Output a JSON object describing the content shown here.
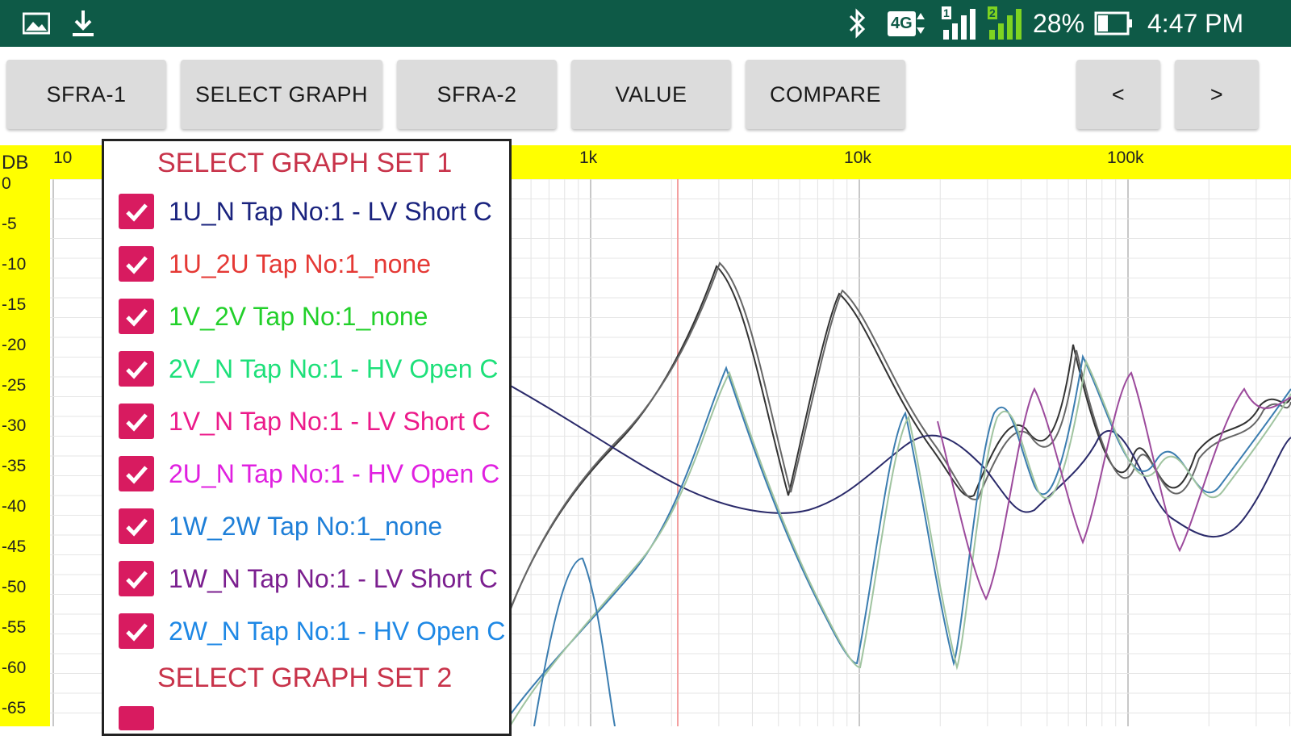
{
  "status_bar": {
    "network": "4G",
    "sim1": "1",
    "sim2": "2",
    "battery_percent": "28%",
    "time": "4:47 PM",
    "icons": [
      "image-icon",
      "download-icon",
      "bluetooth-icon",
      "network-4g-icon",
      "signal-sim1-icon",
      "signal-sim2-icon",
      "battery-icon"
    ]
  },
  "toolbar": {
    "buttons": [
      "SFRA-1",
      "SELECT GRAPH",
      "SFRA-2",
      "VALUE",
      "COMPARE",
      "<",
      ">"
    ]
  },
  "axes": {
    "y_unit": "DB",
    "x_ticks": [
      "10",
      "1k",
      "10k",
      "100k"
    ],
    "y_ticks": [
      "0",
      "-5",
      "-10",
      "-15",
      "-20",
      "-25",
      "-30",
      "-35",
      "-40",
      "-45",
      "-50",
      "-55",
      "-60",
      "-65"
    ]
  },
  "popup": {
    "set1_title": "SELECT GRAPH SET 1",
    "set2_title": "SELECT GRAPH SET 2",
    "items": [
      {
        "label": "1U_N Tap No:1 - LV Short C",
        "color": "#1a237e",
        "checked": true
      },
      {
        "label": "1U_2U Tap No:1_none",
        "color": "#e53935",
        "checked": true
      },
      {
        "label": "1V_2V Tap No:1_none",
        "color": "#22d02a",
        "checked": true
      },
      {
        "label": "2V_N Tap No:1 - HV Open C",
        "color": "#1de07a",
        "checked": true
      },
      {
        "label": "1V_N Tap No:1 - LV Short C",
        "color": "#ec1a8a",
        "checked": true
      },
      {
        "label": "2U_N Tap No:1 - HV Open C",
        "color": "#e020e0",
        "checked": true
      },
      {
        "label": "1W_2W Tap No:1_none",
        "color": "#1e7fd8",
        "checked": true
      },
      {
        "label": "1W_N Tap No:1 - LV Short C",
        "color": "#7b1f8f",
        "checked": true
      },
      {
        "label": "2W_N Tap No:1 - HV Open C",
        "color": "#1e88e5",
        "checked": true
      }
    ]
  },
  "colors": {
    "status_bar": "#0e5a47",
    "axis_strip": "#ffff00",
    "checkbox": "#d81b60",
    "set_header": "#c8334a"
  }
}
